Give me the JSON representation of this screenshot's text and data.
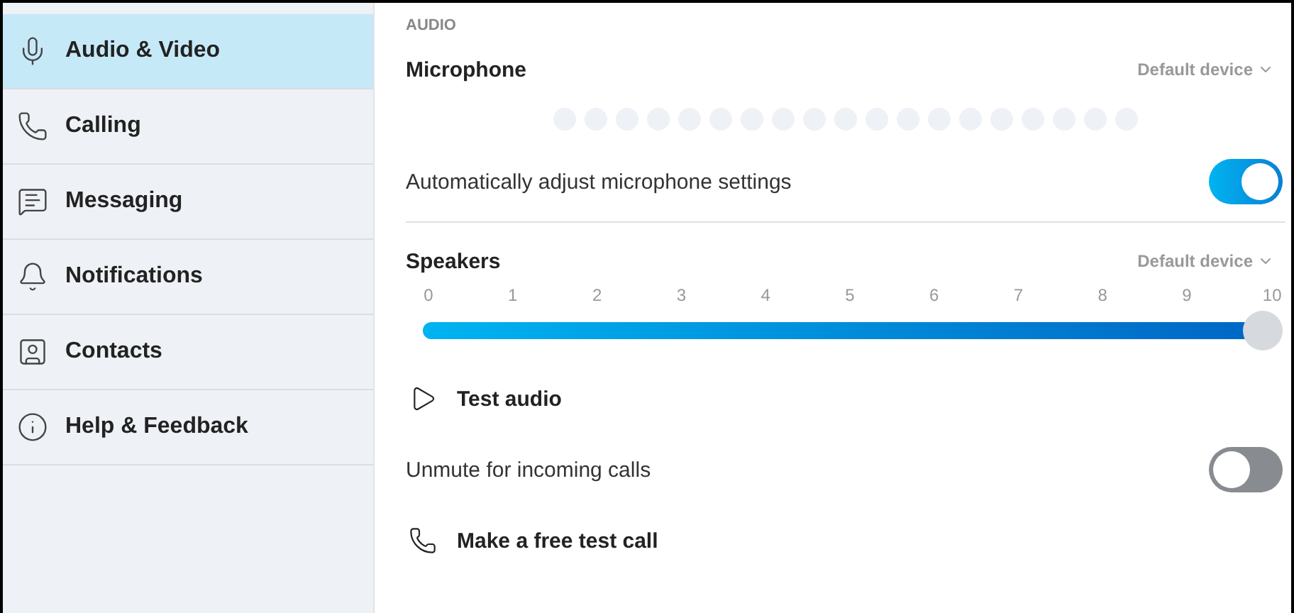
{
  "sidebar": {
    "items": [
      {
        "label": "Audio & Video",
        "selected": true
      },
      {
        "label": "Calling",
        "selected": false
      },
      {
        "label": "Messaging",
        "selected": false
      },
      {
        "label": "Notifications",
        "selected": false
      },
      {
        "label": "Contacts",
        "selected": false
      },
      {
        "label": "Help & Feedback",
        "selected": false
      }
    ]
  },
  "section_label": "AUDIO",
  "microphone": {
    "title": "Microphone",
    "device": "Default device"
  },
  "auto_adjust": {
    "label": "Automatically adjust microphone settings",
    "on": true
  },
  "speakers": {
    "title": "Speakers",
    "device": "Default device",
    "ticks": [
      "0",
      "1",
      "2",
      "3",
      "4",
      "5",
      "6",
      "7",
      "8",
      "9",
      "10"
    ],
    "volume": {
      "level": 1
    }
  },
  "test_audio": {
    "label": "Test audio"
  },
  "unmute": {
    "label": "Unmute for incoming calls",
    "on": false
  },
  "test_call": {
    "label": "Make a free test call"
  }
}
